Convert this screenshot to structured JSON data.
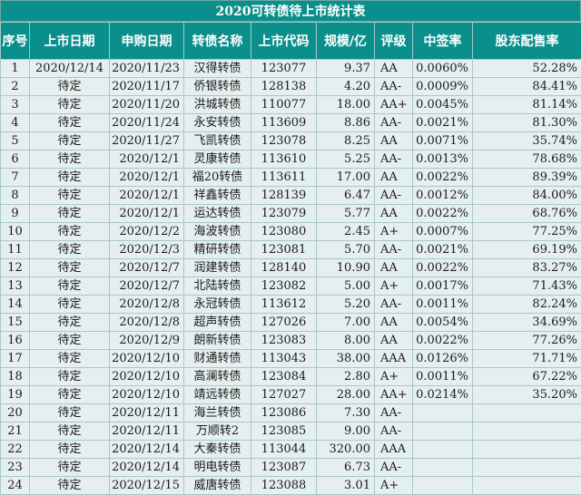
{
  "title": "2020可转债待上市统计表",
  "headers": [
    "序号",
    "上市日期",
    "申购日期",
    "转债名称",
    "上市代码",
    "规模/亿",
    "评级",
    "中签率",
    "股东配售率"
  ],
  "rows": [
    [
      "1",
      "2020/12/14",
      "2020/11/23",
      "汉得转债",
      "123077",
      "9.37",
      "AA",
      "0.0060%",
      "52.28%"
    ],
    [
      "2",
      "待定",
      "2020/11/17",
      "侨银转债",
      "128138",
      "4.20",
      "AA-",
      "0.0009%",
      "84.41%"
    ],
    [
      "3",
      "待定",
      "2020/11/20",
      "洪城转债",
      "110077",
      "18.00",
      "AA+",
      "0.0045%",
      "81.14%"
    ],
    [
      "4",
      "待定",
      "2020/11/24",
      "永安转债",
      "113609",
      "8.86",
      "AA-",
      "0.0021%",
      "81.30%"
    ],
    [
      "5",
      "待定",
      "2020/11/27",
      "飞凯转债",
      "123078",
      "8.25",
      "AA",
      "0.0071%",
      "35.74%"
    ],
    [
      "6",
      "待定",
      "2020/12/1",
      "灵康转债",
      "113610",
      "5.25",
      "AA-",
      "0.0013%",
      "78.68%"
    ],
    [
      "7",
      "待定",
      "2020/12/1",
      "福20转债",
      "113611",
      "17.00",
      "AA",
      "0.0022%",
      "89.39%"
    ],
    [
      "8",
      "待定",
      "2020/12/1",
      "祥鑫转债",
      "128139",
      "6.47",
      "AA-",
      "0.0012%",
      "84.00%"
    ],
    [
      "9",
      "待定",
      "2020/12/1",
      "运达转债",
      "123079",
      "5.77",
      "AA",
      "0.0022%",
      "68.76%"
    ],
    [
      "10",
      "待定",
      "2020/12/2",
      "海波转债",
      "123080",
      "2.45",
      "A+",
      "0.0007%",
      "77.25%"
    ],
    [
      "11",
      "待定",
      "2020/12/3",
      "精研转债",
      "123081",
      "5.70",
      "AA-",
      "0.0021%",
      "69.19%"
    ],
    [
      "12",
      "待定",
      "2020/12/7",
      "润建转债",
      "128140",
      "10.90",
      "AA",
      "0.0022%",
      "83.27%"
    ],
    [
      "13",
      "待定",
      "2020/12/7",
      "北陆转债",
      "123082",
      "5.00",
      "A+",
      "0.0017%",
      "71.43%"
    ],
    [
      "14",
      "待定",
      "2020/12/8",
      "永冠转债",
      "113612",
      "5.20",
      "AA-",
      "0.0011%",
      "82.24%"
    ],
    [
      "15",
      "待定",
      "2020/12/8",
      "超声转债",
      "127026",
      "7.00",
      "AA",
      "0.0054%",
      "34.69%"
    ],
    [
      "16",
      "待定",
      "2020/12/9",
      "朗新转债",
      "123083",
      "8.00",
      "AA",
      "0.0022%",
      "77.26%"
    ],
    [
      "17",
      "待定",
      "2020/12/10",
      "财通转债",
      "113043",
      "38.00",
      "AAA",
      "0.0126%",
      "71.71%"
    ],
    [
      "18",
      "待定",
      "2020/12/10",
      "高澜转债",
      "123084",
      "2.80",
      "A+",
      "0.0011%",
      "67.22%"
    ],
    [
      "19",
      "待定",
      "2020/12/10",
      "靖远转债",
      "127027",
      "28.00",
      "AA+",
      "0.0214%",
      "35.20%"
    ],
    [
      "20",
      "待定",
      "2020/12/11",
      "海兰转债",
      "123086",
      "7.30",
      "AA-",
      "",
      ""
    ],
    [
      "21",
      "待定",
      "2020/12/11",
      "万顺转2",
      "123085",
      "9.00",
      "AA-",
      "",
      ""
    ],
    [
      "22",
      "待定",
      "2020/12/14",
      "大秦转债",
      "113044",
      "320.00",
      "AAA",
      "",
      ""
    ],
    [
      "23",
      "待定",
      "2020/12/14",
      "明电转债",
      "123087",
      "6.73",
      "AA-",
      "",
      ""
    ],
    [
      "24",
      "待定",
      "2020/12/15",
      "威唐转债",
      "123088",
      "3.01",
      "A+",
      "",
      ""
    ]
  ]
}
